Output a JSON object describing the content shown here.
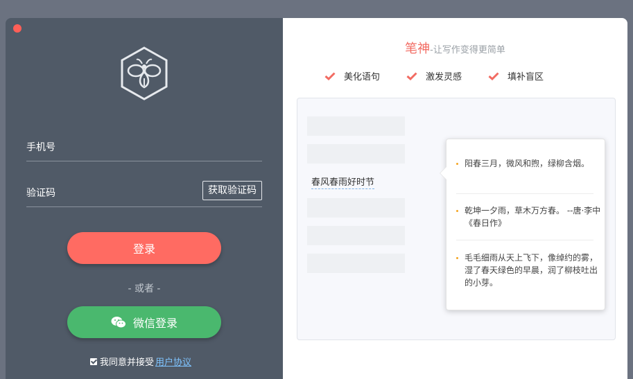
{
  "login": {
    "phone_label": "手机号",
    "code_label": "验证码",
    "get_code_label": "获取验证码",
    "login_label": "登录",
    "or_label": "- 或者 -",
    "wechat_label": "微信登录",
    "agree_text": "我同意并接受",
    "agreement_link": "用户协议"
  },
  "promo": {
    "brand": "笔神",
    "tagline": "-让写作变得更简单",
    "features": [
      "美化语句",
      "激发灵感",
      "填补盲区"
    ]
  },
  "demo": {
    "sample_text": "春风春雨好时节",
    "suggestions": [
      "阳春三月，微风和煦，绿柳含烟。",
      "乾坤一夕雨，草木万方春。 --唐·李中《春日作》",
      "毛毛细雨从天上飞下，像绰约的雾，湿了春天绿色的早晨，润了柳枝吐出的小芽。"
    ]
  },
  "colors": {
    "left_panel": "#505a67",
    "login_button": "#ff6b62",
    "wechat_button": "#4ab86e",
    "brand": "#f26b62",
    "check": "#f26b62",
    "bullet": "#f5a623"
  },
  "icons": {
    "logo": "bee-hexagon-logo",
    "wechat": "wechat-icon",
    "check": "check-icon",
    "close": "close-icon"
  }
}
